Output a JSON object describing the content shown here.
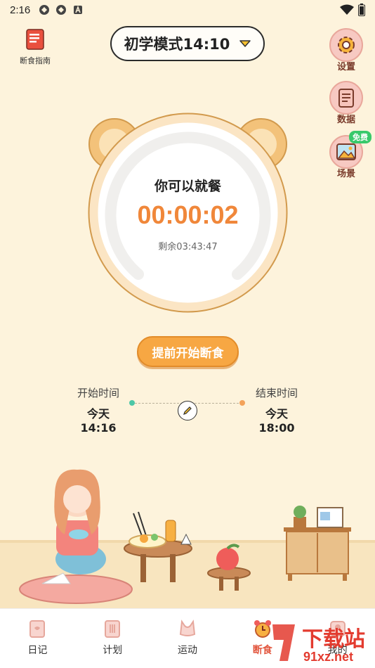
{
  "status_bar": {
    "time": "2:16"
  },
  "guide": {
    "label": "断食指南"
  },
  "mode": {
    "label": "初学模式14:10"
  },
  "side_buttons": [
    {
      "label": "设置"
    },
    {
      "label": "数据"
    },
    {
      "label": "场景",
      "badge": "免费"
    }
  ],
  "clock": {
    "status": "你可以就餐",
    "timer": "00:00:02",
    "remaining": "剩余03:43:47",
    "progress": 0.0
  },
  "start_button": {
    "label": "提前开始断食"
  },
  "times": {
    "start_title": "开始时间",
    "start_value": "今天14:16",
    "end_title": "结束时间",
    "end_value": "今天18:00"
  },
  "nav": [
    {
      "label": "日记"
    },
    {
      "label": "计划"
    },
    {
      "label": "运动"
    },
    {
      "label": "断食",
      "active": true
    },
    {
      "label": "我的"
    }
  ],
  "watermark": {
    "text": "下载站",
    "url": "91xz.net"
  },
  "colors": {
    "background": "#fdf3dc",
    "accent": "#f0873a",
    "button": "#f7a743",
    "active_nav": "#e2573f"
  }
}
